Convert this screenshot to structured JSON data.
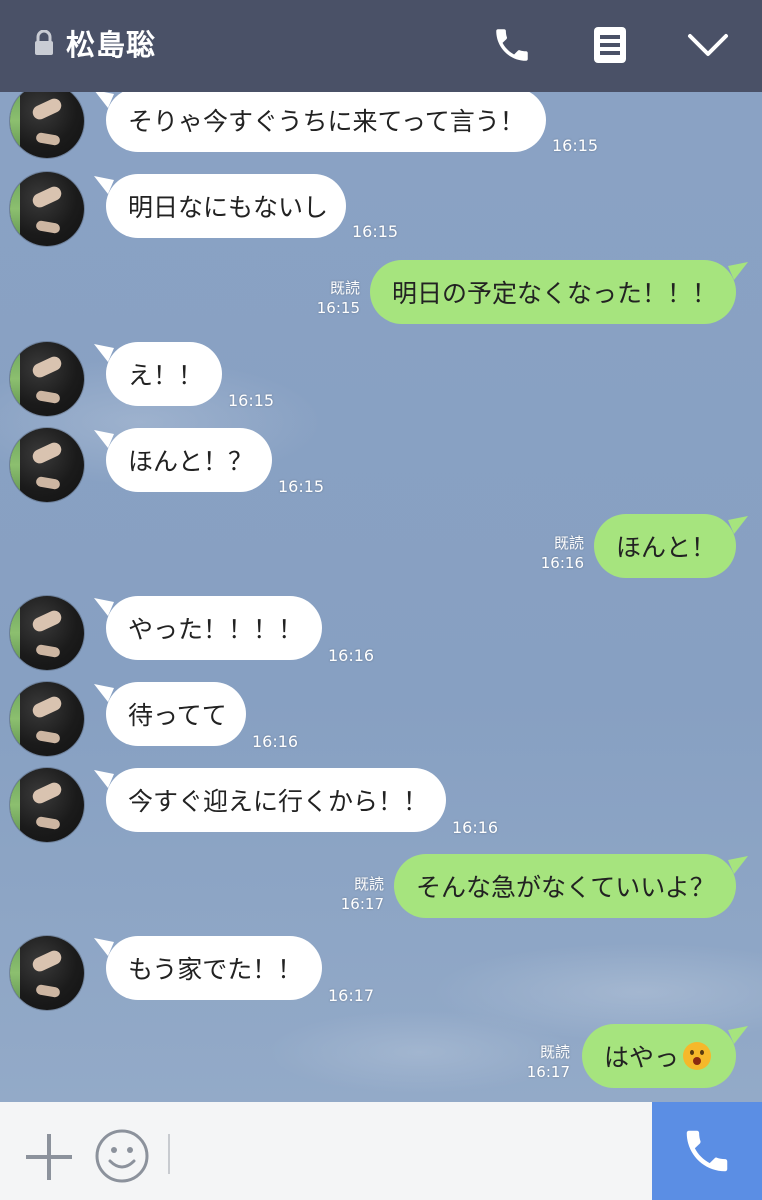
{
  "header": {
    "title": "松島聡",
    "icons": [
      "lock-icon",
      "phone-icon",
      "notes-icon",
      "chevron-down-icon"
    ]
  },
  "messages": [
    {
      "side": "in",
      "text": "そりゃ今すぐうちに来てって言う！",
      "time": "16:15"
    },
    {
      "side": "in",
      "text": "明日なにもないし",
      "time": "16:15"
    },
    {
      "side": "out",
      "text": "明日の予定なくなった！！！",
      "time": "16:15",
      "read": "既読"
    },
    {
      "side": "in",
      "text": "え！！",
      "time": "16:15"
    },
    {
      "side": "in",
      "text": "ほんと！？",
      "time": "16:15"
    },
    {
      "side": "out",
      "text": "ほんと！",
      "time": "16:16",
      "read": "既読"
    },
    {
      "side": "in",
      "text": "やった！！！！",
      "time": "16:16"
    },
    {
      "side": "in",
      "text": "待ってて",
      "time": "16:16"
    },
    {
      "side": "in",
      "text": "今すぐ迎えに行くから！！",
      "time": "16:16"
    },
    {
      "side": "out",
      "text": "そんな急がなくていいよ？",
      "time": "16:17",
      "read": "既読"
    },
    {
      "side": "in",
      "text": "もう家でた！！",
      "time": "16:17"
    },
    {
      "side": "out",
      "text": "はやっ",
      "time": "16:17",
      "read": "既読",
      "emoji": "screaming-face-emoji"
    }
  ],
  "colors": {
    "header": "#4a5167",
    "incoming_bubble": "#ffffff",
    "outgoing_bubble": "#a6e47e",
    "call_button": "#5b8ee4"
  }
}
